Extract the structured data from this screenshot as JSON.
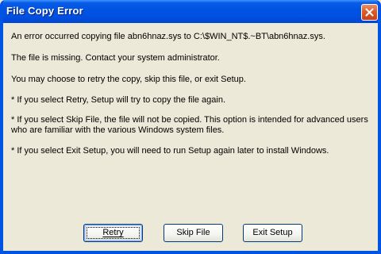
{
  "window": {
    "title": "File Copy Error"
  },
  "messages": [
    "An error occurred copying file abn6hnaz.sys to C:\\$WIN_NT$.~BT\\abn6hnaz.sys.",
    "The file is missing. Contact your system administrator.",
    "You may choose to retry the copy, skip this file, or exit Setup.",
    "* If you select Retry, Setup will try to copy the file again.",
    "* If you select Skip File, the file will not be copied. This option is intended for advanced users who are familiar with the various Windows system files.",
    "* If you select Exit Setup, you will need to run Setup again later to install Windows."
  ],
  "buttons": {
    "retry_label": "Retry",
    "skip_label": "Skip File",
    "exit_label": "Exit Setup"
  },
  "icons": {
    "close": "close-icon"
  },
  "colors": {
    "titlebar": "#0054e3",
    "close_button": "#db5c2a",
    "dialog_background": "#ece9d8"
  }
}
